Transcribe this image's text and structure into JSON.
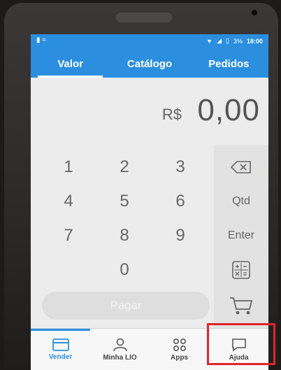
{
  "status_bar": {
    "battery_pct": "3%",
    "time": "18:00"
  },
  "tabs": [
    {
      "label": "Valor",
      "active": true
    },
    {
      "label": "Catálogo",
      "active": false
    },
    {
      "label": "Pedidos",
      "active": false
    }
  ],
  "amount": {
    "currency": "R$",
    "value": "0,00"
  },
  "keypad": {
    "digits": [
      "1",
      "2",
      "3",
      "4",
      "5",
      "6",
      "7",
      "8",
      "9",
      "0"
    ],
    "qtd_label": "Qtd",
    "enter_label": "Enter",
    "pay_label": "Pagar"
  },
  "bottom_nav": [
    {
      "label": "Vender",
      "icon": "card-icon",
      "active": true
    },
    {
      "label": "Minha LIO",
      "icon": "person-icon",
      "active": false
    },
    {
      "label": "Apps",
      "icon": "apps-grid-icon",
      "active": false
    },
    {
      "label": "Ajuda",
      "icon": "chat-bubble-icon",
      "active": false
    }
  ],
  "colors": {
    "primary": "#2b8ede",
    "highlight": "#e0242b"
  }
}
